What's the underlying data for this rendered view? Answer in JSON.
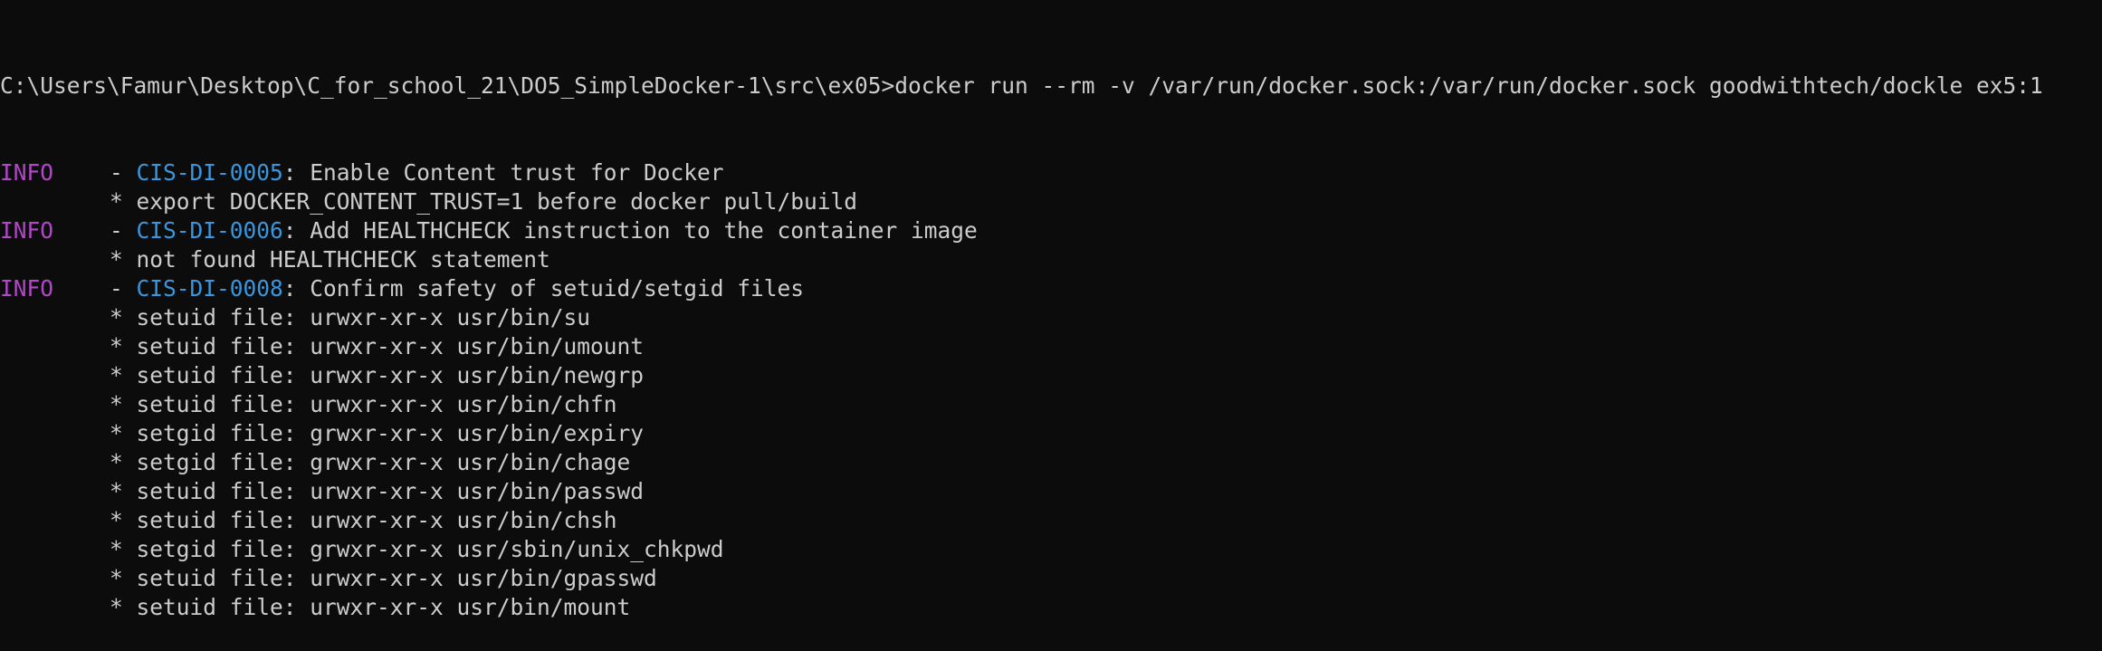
{
  "colors": {
    "background": "#0c0c0c",
    "text": "#cccccc",
    "info_level": "#b148c6",
    "cis_code": "#3a96dd"
  },
  "terminal": {
    "prompt": "C:\\Users\\Famur\\Desktop\\C_for_school_21\\DO5_SimpleDocker-1\\src\\ex05>",
    "command": "docker run --rm -v /var/run/docker.sock:/var/run/docker.sock goodwithtech/dockle ex5:1",
    "findings": [
      {
        "level": "INFO",
        "dash": "- ",
        "code": "CIS-DI-0005",
        "title": ": Enable Content trust for Docker",
        "details": [
          "* export DOCKER_CONTENT_TRUST=1 before docker pull/build"
        ]
      },
      {
        "level": "INFO",
        "dash": "- ",
        "code": "CIS-DI-0006",
        "title": ": Add HEALTHCHECK instruction to the container image",
        "details": [
          "* not found HEALTHCHECK statement"
        ]
      },
      {
        "level": "INFO",
        "dash": "- ",
        "code": "CIS-DI-0008",
        "title": ": Confirm safety of setuid/setgid files",
        "details": [
          "* setuid file: urwxr-xr-x usr/bin/su",
          "* setuid file: urwxr-xr-x usr/bin/umount",
          "* setuid file: urwxr-xr-x usr/bin/newgrp",
          "* setuid file: urwxr-xr-x usr/bin/chfn",
          "* setgid file: grwxr-xr-x usr/bin/expiry",
          "* setgid file: grwxr-xr-x usr/bin/chage",
          "* setuid file: urwxr-xr-x usr/bin/passwd",
          "* setuid file: urwxr-xr-x usr/bin/chsh",
          "* setgid file: grwxr-xr-x usr/sbin/unix_chkpwd",
          "* setuid file: urwxr-xr-x usr/bin/gpasswd",
          "* setuid file: urwxr-xr-x usr/bin/mount"
        ]
      }
    ]
  }
}
